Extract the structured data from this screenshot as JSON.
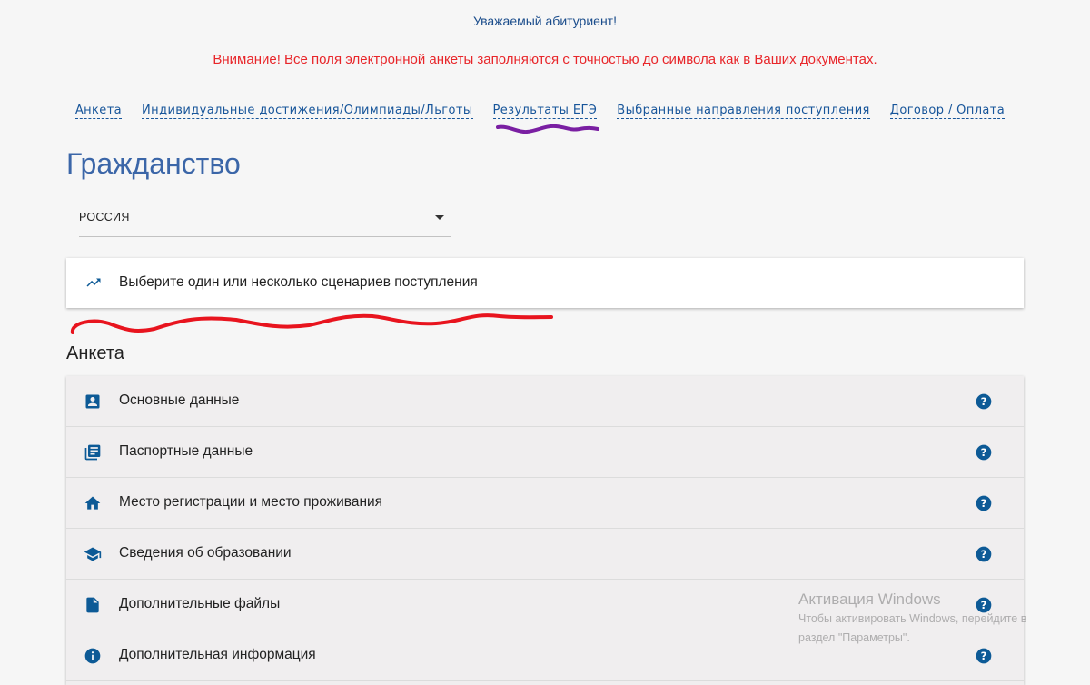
{
  "header": {
    "greeting": "Уважаемый абитуриент!",
    "warning": "Внимание! Все поля электронной анкеты заполняются с точностью до символа как в Ваших документах."
  },
  "nav": {
    "items": [
      {
        "label": "Анкета"
      },
      {
        "label": "Индивидуальные достижения/Олимпиады/Льготы"
      },
      {
        "label": "Результаты ЕГЭ"
      },
      {
        "label": "Выбранные направления поступления"
      },
      {
        "label": "Договор / Оплата"
      }
    ]
  },
  "citizenship": {
    "title": "Гражданство",
    "selected": "РОССИЯ"
  },
  "scenario_card": {
    "icon": "trending-up-icon",
    "label": "Выберите один или несколько сценариев поступления"
  },
  "anketa": {
    "title": "Анкета",
    "items": [
      {
        "label": "Основные данные",
        "icon": "account-box-icon"
      },
      {
        "label": "Паспортные данные",
        "icon": "library-books-icon"
      },
      {
        "label": "Место регистрации и место проживания",
        "icon": "home-icon"
      },
      {
        "label": "Сведения об образовании",
        "icon": "school-icon"
      },
      {
        "label": "Дополнительные файлы",
        "icon": "file-icon"
      },
      {
        "label": "Дополнительная информация",
        "icon": "info-icon"
      }
    ]
  },
  "watermark": {
    "title": "Активация Windows",
    "line1": "Чтобы активировать Windows, перейдите в",
    "line2": "раздел \"Параметры\"."
  },
  "colors": {
    "accent": "#17559a",
    "icon": "#0d5a96",
    "warning": "#e8262a",
    "title": "#3b66a8",
    "annotation_purple": "#7a1fa2",
    "annotation_red": "#e8141e"
  }
}
